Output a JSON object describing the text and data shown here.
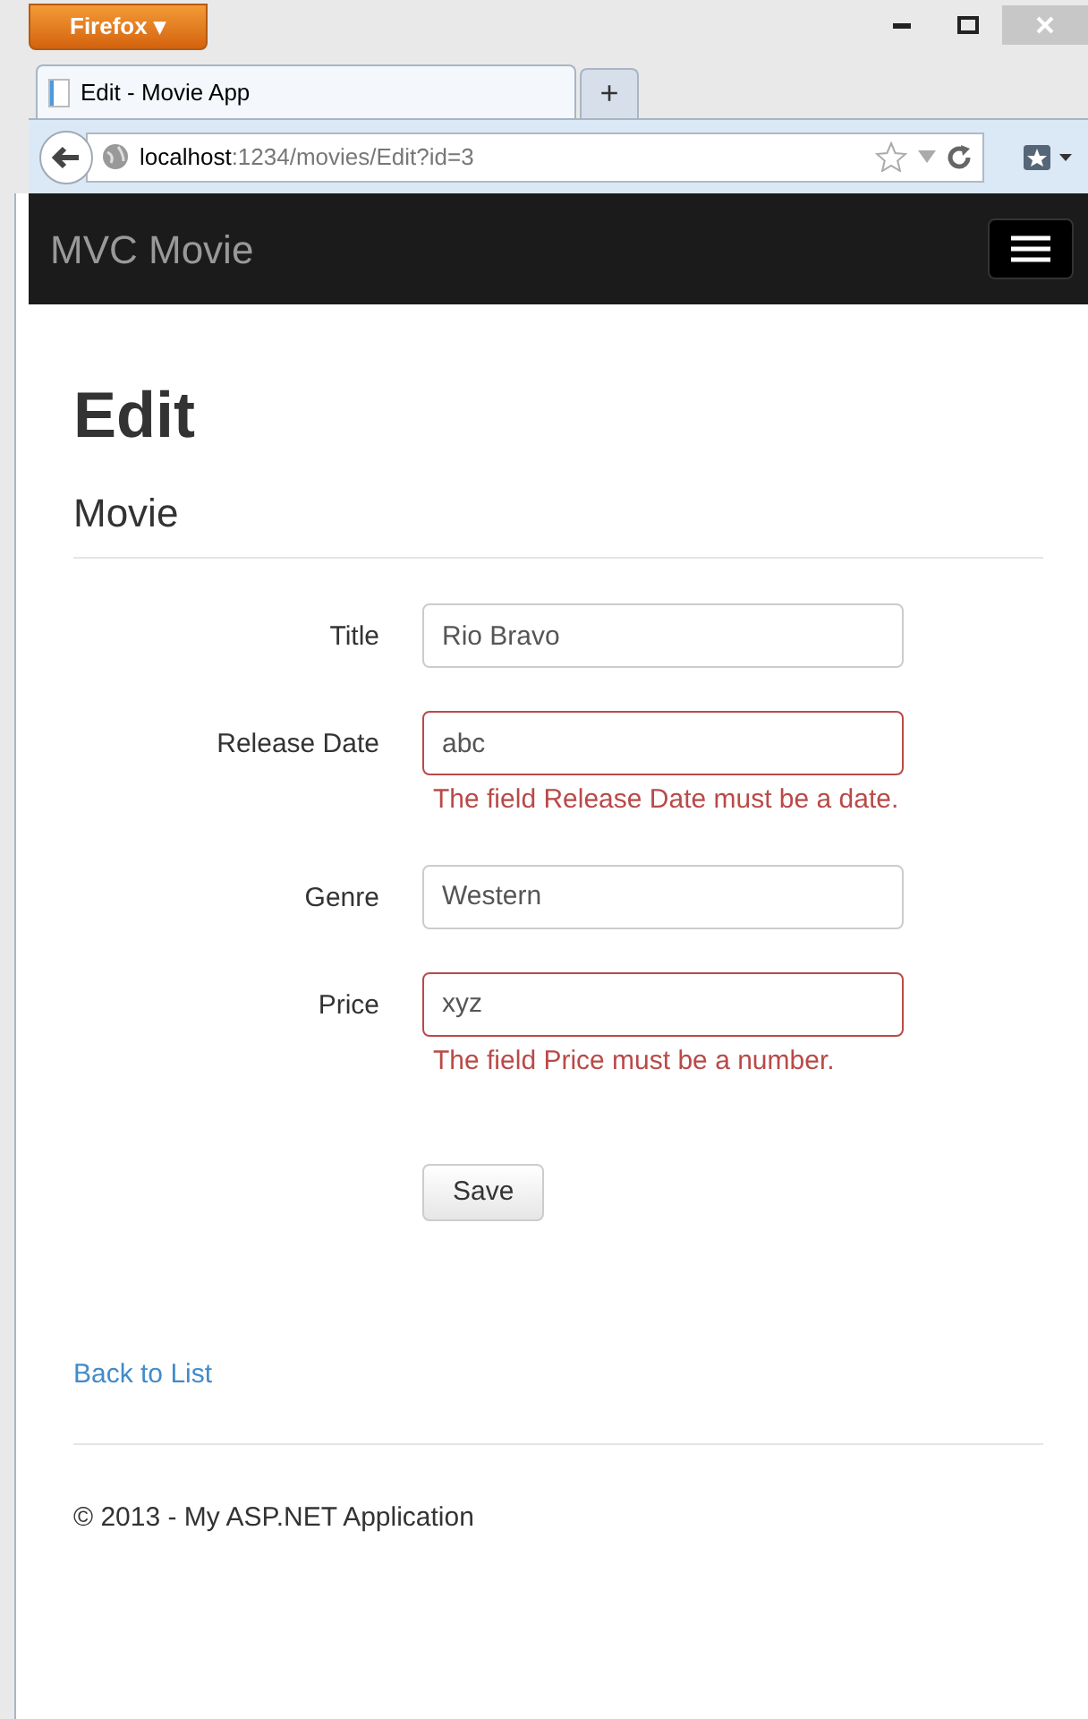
{
  "browser": {
    "menu_button": "Firefox ▾",
    "tab_title": "Edit - Movie App",
    "new_tab": "+",
    "url_host": "localhost",
    "url_path": ":1234/movies/Edit?id=3"
  },
  "navbar": {
    "brand": "MVC Movie"
  },
  "heading": "Edit",
  "subheading": "Movie",
  "fields": [
    {
      "label": "Title",
      "value": "Rio Bravo",
      "invalid": false
    },
    {
      "label": "Release Date",
      "value": "abc",
      "invalid": true,
      "error": "The field Release Date must be a date."
    },
    {
      "label": "Genre",
      "value": "Western",
      "invalid": false
    },
    {
      "label": "Price",
      "value": "xyz",
      "invalid": true,
      "error": "The field Price must be a number."
    }
  ],
  "save_button": "Save",
  "back_link": "Back to List",
  "footer": "© 2013 - My ASP.NET Application"
}
